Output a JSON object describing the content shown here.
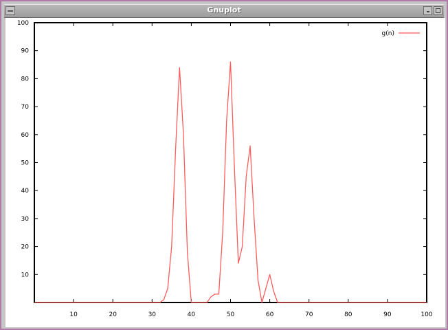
{
  "window": {
    "title": "Gnuplot"
  },
  "colors": {
    "series": "#ff5b5b",
    "axis": "#000000"
  },
  "chart_data": {
    "type": "line",
    "title": "",
    "xlabel": "",
    "ylabel": "",
    "xlim": [
      0,
      100
    ],
    "ylim": [
      0,
      100
    ],
    "xticks": [
      10,
      20,
      30,
      40,
      50,
      60,
      70,
      80,
      90,
      100
    ],
    "yticks": [
      10,
      20,
      30,
      40,
      50,
      60,
      70,
      80,
      90,
      100
    ],
    "legend": "top-right",
    "series": [
      {
        "name": "g(n)",
        "x": [
          0,
          32,
          33,
          34,
          35,
          36,
          37,
          38,
          39,
          40,
          41,
          42,
          43,
          44,
          45,
          46,
          47,
          48,
          49,
          50,
          51,
          52,
          53,
          54,
          55,
          56,
          57,
          58,
          59,
          60,
          61,
          62,
          100
        ],
        "y": [
          0,
          0,
          1,
          5,
          20,
          55,
          84,
          60,
          18,
          0,
          0,
          0,
          0,
          0,
          2,
          3,
          3,
          25,
          65,
          86,
          48,
          14,
          20,
          45,
          56,
          30,
          8,
          0,
          5,
          10,
          4,
          0,
          0
        ]
      }
    ]
  }
}
